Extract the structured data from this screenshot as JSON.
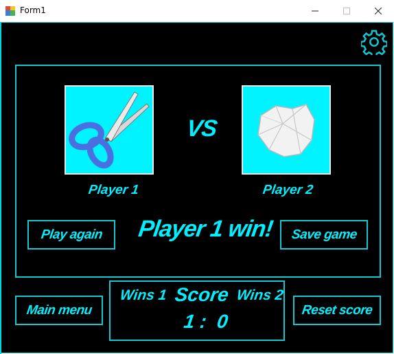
{
  "window": {
    "title": "Form1"
  },
  "icons": {
    "app": "app-form-icon",
    "minimize": "minimize-icon",
    "maximize": "maximize-icon",
    "close": "close-icon",
    "settings": "gear-icon",
    "player1_choice": "scissors-icon",
    "player2_choice": "crumpled-paper-icon"
  },
  "colors": {
    "accent": "#00f0ff",
    "background": "#000000",
    "border": "#11c8d4",
    "choice_bg": "#00f4ff"
  },
  "game": {
    "vs_label": "VS",
    "player1_label": "Player 1",
    "player2_label": "Player 2",
    "result_text": "Player 1 win!",
    "play_again_label": "Play again",
    "save_game_label": "Save game"
  },
  "scoreboard": {
    "wins1_label": "Wins 1",
    "score_label": "Score",
    "wins2_label": "Wins 2",
    "tally": "1 :  0"
  },
  "bottom": {
    "main_menu_label": "Main menu",
    "reset_score_label": "Reset score"
  }
}
